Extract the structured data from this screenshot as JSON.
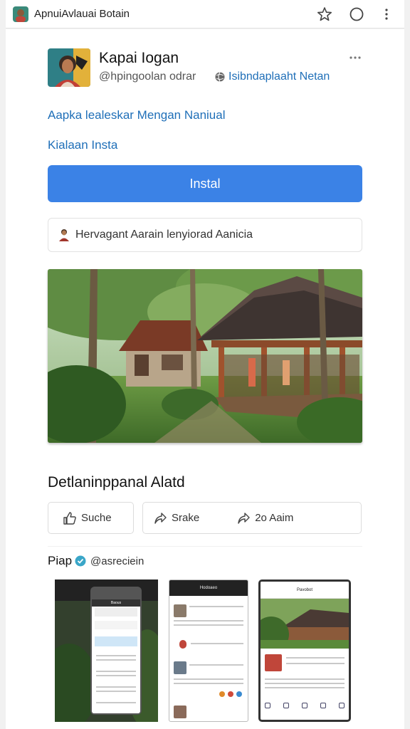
{
  "topbar": {
    "title": "ApnuiAvlauai Botain",
    "icons": [
      "favicon-avatar",
      "star-icon",
      "circle-icon",
      "kebab-menu-icon"
    ]
  },
  "app": {
    "name": "Kapai Iogan",
    "developer": "@hpingoolan odrar",
    "website": "Isibndaplaaht Netan",
    "link_primary": "Aapka lealeskar Mengan Naniual",
    "link_secondary": "Kialaan Insta",
    "install_label": "Instal",
    "permission_text": "Hervagant Aarain lenyiorad Aanicia"
  },
  "section": {
    "title": "Detlaninppanal Alatd"
  },
  "actions": {
    "share": "Suche",
    "snake": "Srake",
    "forward": "2o Aaim"
  },
  "screenshots": {
    "title": "Piap",
    "handle": "@asreciein",
    "shot2_header": "Hodoaeo",
    "shot3_header": "Pavobot",
    "shot1_header": "Baous"
  },
  "colors": {
    "accent": "#3b82e6",
    "link": "#1f6fb8"
  }
}
